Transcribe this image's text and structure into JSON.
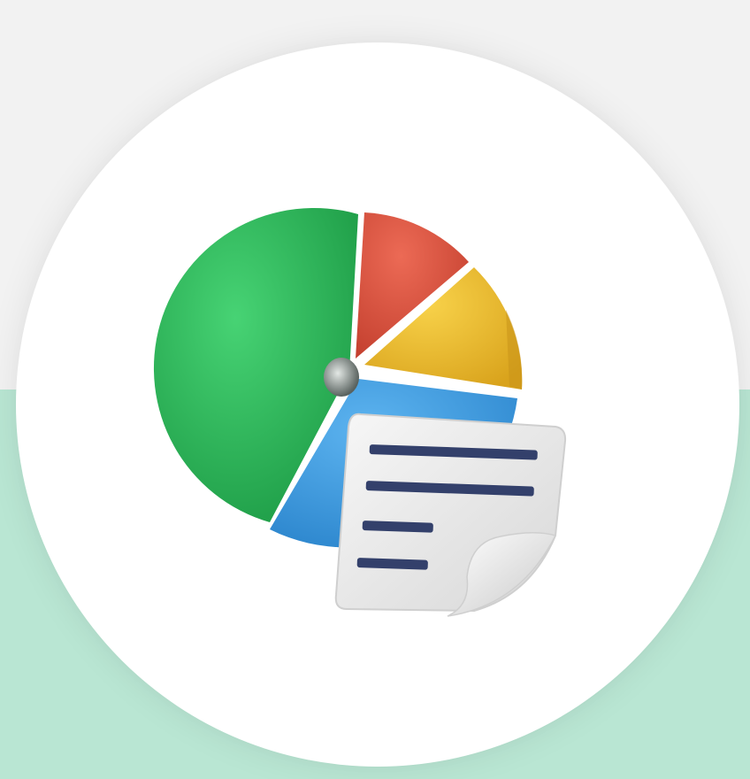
{
  "colors": {
    "background_top": "#f2f2f2",
    "background_bottom": "#b9e6d3",
    "circle": "#ffffff",
    "slice_green": "#2fbf5f",
    "slice_red": "#e0533f",
    "slice_yellow": "#f2c12e",
    "slice_blue": "#3d9ee6",
    "pie_hub": "#9aa3a0",
    "document_paper": "#ececec",
    "document_lines": "#33406b"
  },
  "illustration": {
    "icon": "pie-chart-report-icon"
  }
}
